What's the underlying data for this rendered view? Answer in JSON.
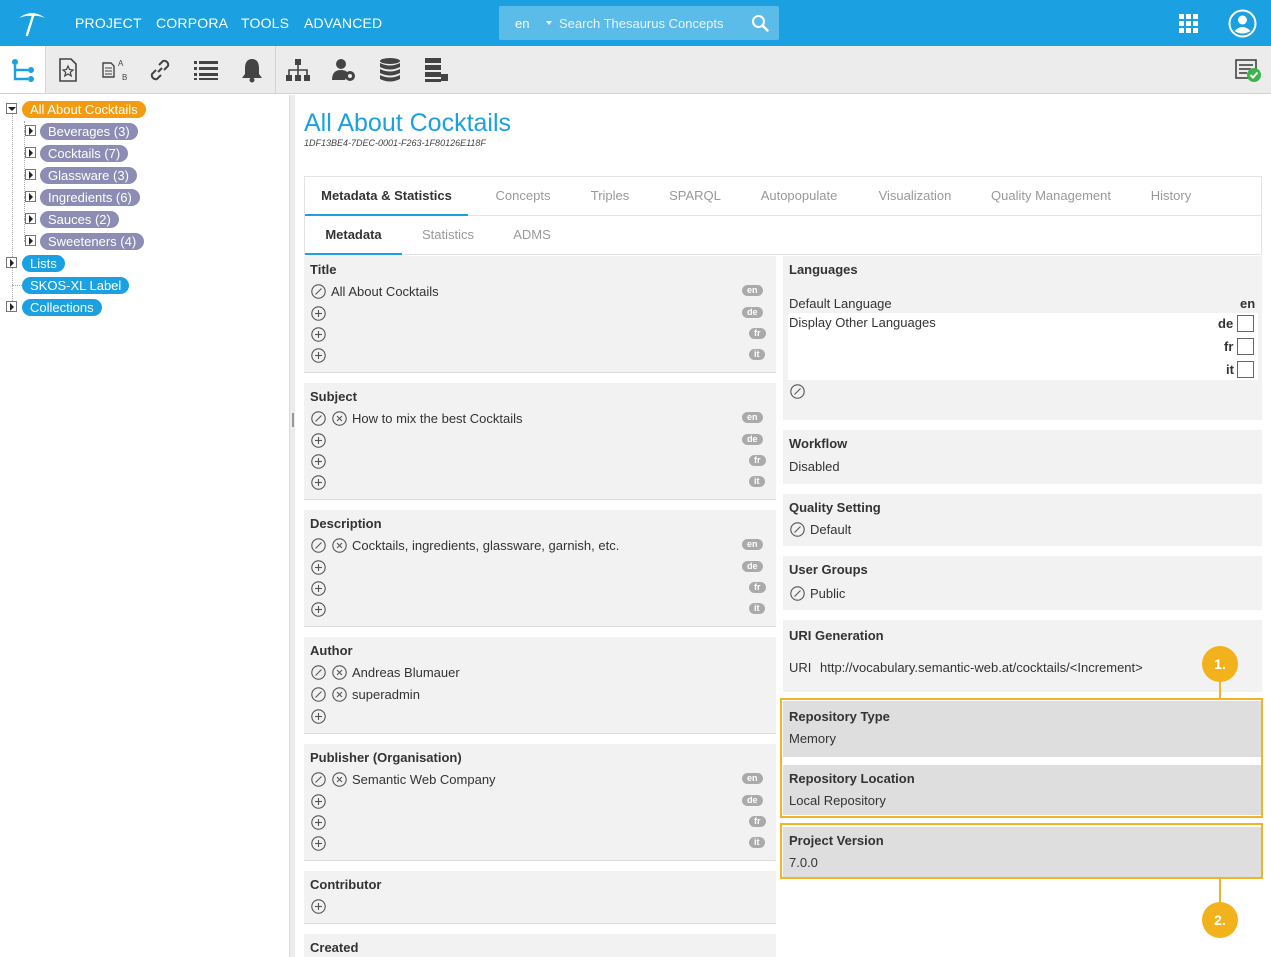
{
  "colors": {
    "accent": "#1ba1e2",
    "highlight": "#f0b429",
    "tree_root": "#f39c12",
    "tree_node": "#8c8cb4"
  },
  "topbar": {
    "logo": "poolparty-logo-icon",
    "nav": [
      "PROJECT",
      "CORPORA",
      "TOOLS",
      "ADVANCED"
    ],
    "search": {
      "lang": "en",
      "placeholder": "Search Thesaurus Concepts"
    }
  },
  "toolbar": {
    "buttons": [
      "hierarchy-tree-icon",
      "favorites-icon",
      "label-translate-icon",
      "link-icon",
      "list-icon",
      "notification-bell-icon",
      "org-chart-icon",
      "user-settings-icon",
      "database-icon",
      "database-server-icon"
    ],
    "right_button": "validation-report-icon"
  },
  "tree": {
    "root": "All About Cocktails",
    "children": [
      "Beverages (3)",
      "Cocktails (7)",
      "Glassware (3)",
      "Ingredients (6)",
      "Sauces (2)",
      "Sweeteners (4)"
    ],
    "others": [
      "Lists",
      "SKOS-XL Label",
      "Collections"
    ]
  },
  "project": {
    "title": "All About Cocktails",
    "uuid": "1DF13BE4-7DEC-0001-F263-1F80126E118F"
  },
  "tabs": [
    "Metadata & Statistics",
    "Concepts",
    "Triples",
    "SPARQL",
    "Autopopulate",
    "Visualization",
    "Quality Management",
    "History"
  ],
  "subtabs": [
    "Metadata",
    "Statistics",
    "ADMS"
  ],
  "metadata_left": {
    "title": {
      "label": "Title",
      "value": "All About Cocktails",
      "langs": [
        "en",
        "de",
        "fr",
        "it"
      ]
    },
    "subject": {
      "label": "Subject",
      "value": "How to mix the best Cocktails",
      "langs": [
        "en",
        "de",
        "fr",
        "it"
      ]
    },
    "description": {
      "label": "Description",
      "value": "Cocktails, ingredients, glassware, garnish, etc.",
      "langs": [
        "en",
        "de",
        "fr",
        "it"
      ]
    },
    "author": {
      "label": "Author",
      "values": [
        "Andreas Blumauer",
        "superadmin"
      ]
    },
    "publisher": {
      "label": "Publisher (Organisation)",
      "value": "Semantic Web Company",
      "langs": [
        "en",
        "de",
        "fr",
        "it"
      ]
    },
    "contributor": {
      "label": "Contributor"
    },
    "created": {
      "label": "Created"
    }
  },
  "metadata_right": {
    "languages": {
      "label": "Languages",
      "default_label": "Default Language",
      "default_value": "en",
      "other_label": "Display Other Languages",
      "other": [
        "de",
        "fr",
        "it"
      ]
    },
    "workflow": {
      "label": "Workflow",
      "value": "Disabled"
    },
    "quality": {
      "label": "Quality Setting",
      "value": "Default"
    },
    "user_groups": {
      "label": "User Groups",
      "value": "Public"
    },
    "uri_generation": {
      "label": "URI Generation",
      "prefix": "URI",
      "value": "http://vocabulary.semantic-web.at/cocktails/<Increment>"
    },
    "repo_type": {
      "label": "Repository Type",
      "value": "Memory"
    },
    "repo_location": {
      "label": "Repository Location",
      "value": "Local Repository"
    },
    "project_version": {
      "label": "Project Version",
      "value": "7.0.0"
    }
  },
  "callouts": [
    "1.",
    "2."
  ]
}
